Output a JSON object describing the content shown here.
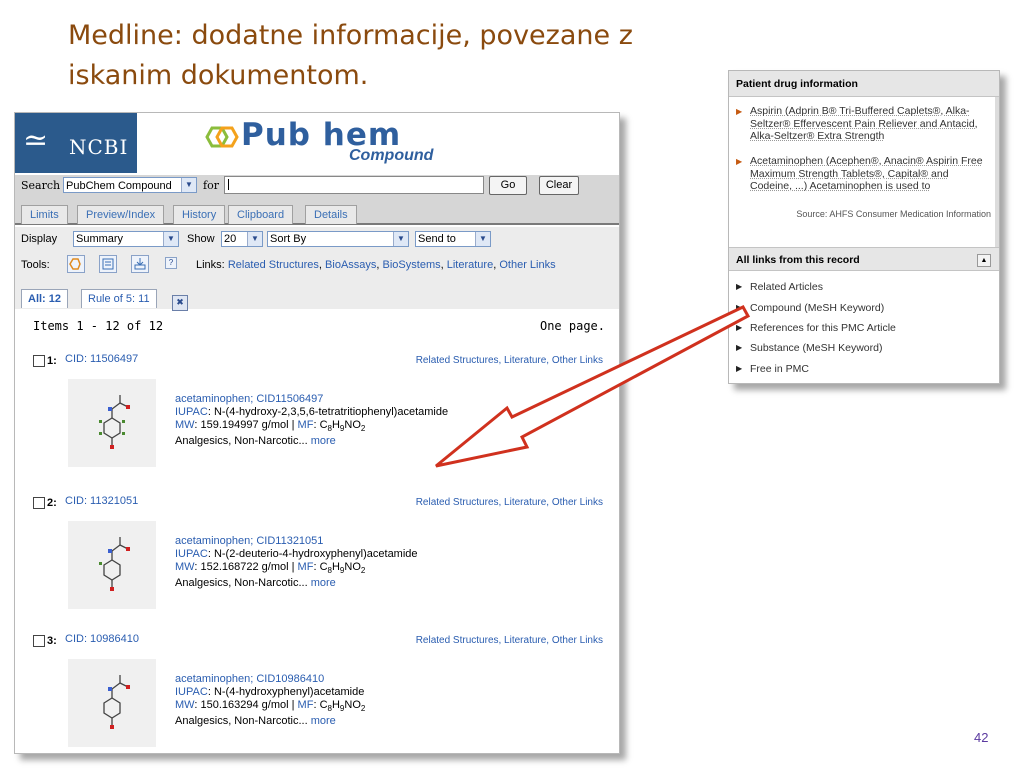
{
  "slide": {
    "title": "Medline: dodatne informacije, povezane z iskanim dokumentom.",
    "page_number": "42"
  },
  "pubchem": {
    "ncbi_label": "NCBI",
    "logo_main": "Pub hem",
    "logo_sub": "Compound",
    "search": {
      "label": "Search",
      "database": "PubChem Compound",
      "for_label": "for",
      "query": "",
      "go_label": "Go",
      "clear_label": "Clear"
    },
    "tabs": [
      "Limits",
      "Preview/Index",
      "History",
      "Clipboard",
      "Details"
    ],
    "display": {
      "display_label": "Display",
      "display_value": "Summary",
      "show_label": "Show",
      "show_value": "20",
      "sort_value": "Sort By",
      "send_value": "Send to"
    },
    "tools": {
      "label": "Tools:",
      "links_label": "Links:",
      "links": [
        "Related Structures",
        "BioAssays",
        "BioSystems",
        "Literature",
        "Other Links"
      ]
    },
    "subtabs": [
      "All: 12",
      "Rule of 5: 11"
    ],
    "items_text": "Items 1 - 12 of 12",
    "pages_text": "One page.",
    "results": [
      {
        "num": "1:",
        "cid": "CID: 11506497",
        "links": "Related Structures, Literature, Other Links",
        "name": "acetaminophen; CID11506497",
        "iupac_label": "IUPAC",
        "iupac": "N-(4-hydroxy-2,3,5,6-tetratritiophenyl)acetamide",
        "mw_label": "MW",
        "mw": "159.194997 g/mol",
        "mf_label": "MF",
        "mf": "C8H9NO2",
        "class": "Analgesics, Non-Narcotic...",
        "more": "more"
      },
      {
        "num": "2:",
        "cid": "CID: 11321051",
        "links": "Related Structures, Literature, Other Links",
        "name": "acetaminophen; CID11321051",
        "iupac_label": "IUPAC",
        "iupac": "N-(2-deuterio-4-hydroxyphenyl)acetamide",
        "mw_label": "MW",
        "mw": "152.168722 g/mol",
        "mf_label": "MF",
        "mf": "C8H9NO2",
        "class": "Analgesics, Non-Narcotic...",
        "more": "more"
      },
      {
        "num": "3:",
        "cid": "CID: 10986410",
        "links": "Related Structures, Literature, Other Links",
        "name": "acetaminophen; CID10986410",
        "iupac_label": "IUPAC",
        "iupac": "N-(4-hydroxyphenyl)acetamide",
        "mw_label": "MW",
        "mw": "150.163294 g/mol",
        "mf_label": "MF",
        "mf": "C8H9NO2",
        "class": "Analgesics, Non-Narcotic...",
        "more": "more"
      }
    ]
  },
  "right_panel": {
    "drug_header": "Patient drug information",
    "drug_items": [
      "Aspirin (Adprin B® Tri-Buffered Caplets®, Alka-Seltzer® Effervescent Pain Reliever and Antacid, Alka-Seltzer® Extra Strength",
      "Acetaminophen (Acephen®, Anacin® Aspirin Free Maximum Strength Tablets®, Capital® and Codeine, ...)  Acetaminophen is used to"
    ],
    "source": "Source: AHFS Consumer Medication Information",
    "links_header": "All links from this record",
    "links": [
      "Related Articles",
      "Compound (MeSH Keyword)",
      "References for this PMC Article",
      "Substance (MeSH Keyword)",
      "Free in PMC"
    ]
  },
  "colors": {
    "title": "#8a4a0e",
    "link": "#2a5db0",
    "arrow": "#d0311e",
    "ncbi_blue": "#2b5a8c"
  }
}
